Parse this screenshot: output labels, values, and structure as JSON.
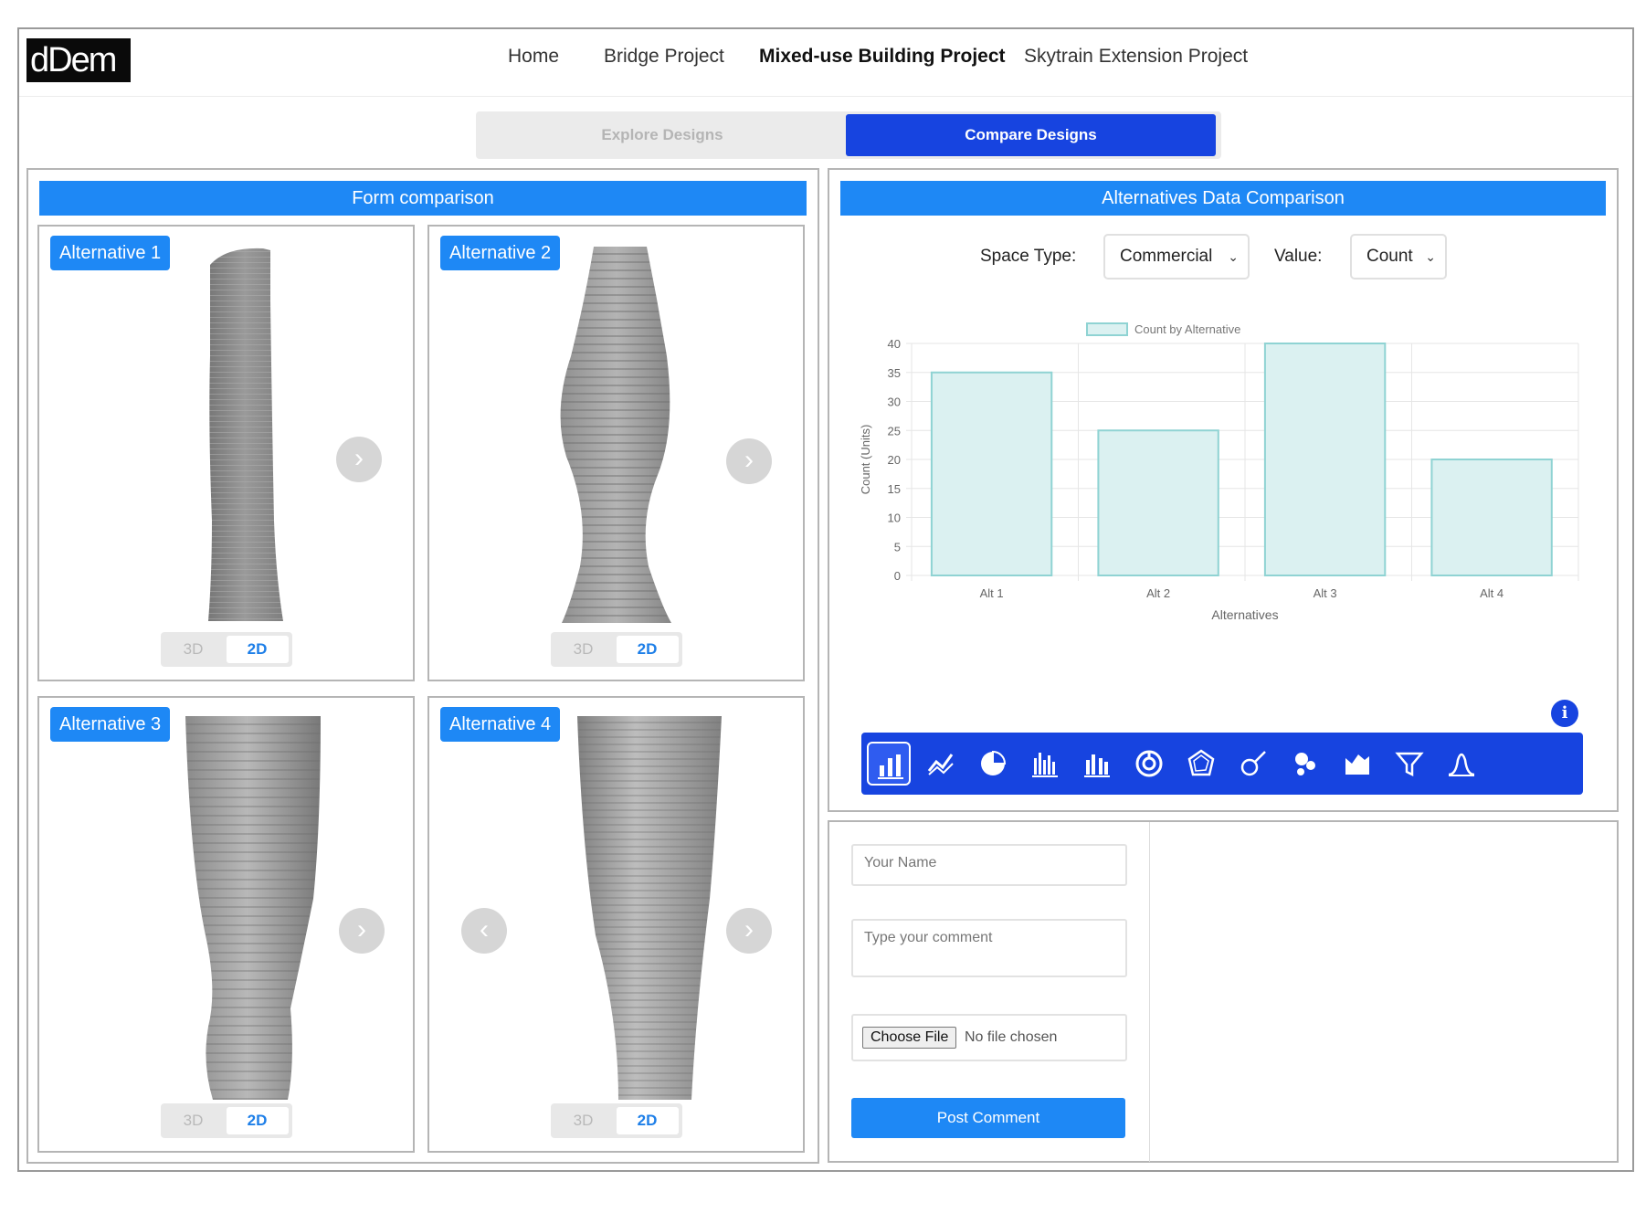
{
  "logo": {
    "text": "dDem"
  },
  "nav": {
    "items": [
      {
        "label": "Home"
      },
      {
        "label": "Bridge Project"
      },
      {
        "label": "Mixed-use Building Project"
      },
      {
        "label": "Skytrain Extension Project"
      }
    ],
    "active_index": 2
  },
  "mode_toggle": {
    "explore_label": "Explore Designs",
    "compare_label": "Compare Designs",
    "active": "compare"
  },
  "form_comparison": {
    "title": "Form comparison",
    "alternatives": [
      {
        "label": "Alternative 1",
        "toggle_3d": "3D",
        "toggle_2d": "2D",
        "active_view": "2D",
        "arrows": [
          "chevron-right"
        ]
      },
      {
        "label": "Alternative 2",
        "toggle_3d": "3D",
        "toggle_2d": "2D",
        "active_view": "2D",
        "arrows": [
          "chevron-right"
        ]
      },
      {
        "label": "Alternative 3",
        "toggle_3d": "3D",
        "toggle_2d": "2D",
        "active_view": "2D",
        "arrows": [
          "chevron-right"
        ]
      },
      {
        "label": "Alternative 4",
        "toggle_3d": "3D",
        "toggle_2d": "2D",
        "active_view": "2D",
        "arrows": [
          "chevron-left",
          "chevron-right"
        ]
      }
    ]
  },
  "data_comparison": {
    "title": "Alternatives Data Comparison",
    "space_type_label": "Space Type:",
    "space_type_value": "Commercial",
    "value_label": "Value:",
    "value_value": "Count",
    "info_icon": "i"
  },
  "chart_data": {
    "type": "bar",
    "categories": [
      "Alt 1",
      "Alt 2",
      "Alt 3",
      "Alt 4"
    ],
    "series": [
      {
        "name": "Count by Alternative",
        "values": [
          35,
          25,
          40,
          20
        ]
      }
    ],
    "xlabel": "Alternatives",
    "ylabel": "Count (Units)",
    "ylim": [
      0,
      40
    ],
    "yticks": [
      0,
      5,
      10,
      15,
      20,
      25,
      30,
      35,
      40
    ],
    "grid": true,
    "legend_position": "top",
    "bar_fill": "#dbf1f1",
    "bar_stroke": "#8fd3d3"
  },
  "chart_toolbar": {
    "tools": [
      "bar-chart-icon",
      "line-chart-icon",
      "pie-chart-icon",
      "histogram-icon",
      "grouped-bar-icon",
      "donut-chart-icon",
      "radar-chart-icon",
      "scatter-chart-icon",
      "bubble-chart-icon",
      "area-chart-icon",
      "funnel-chart-icon",
      "distribution-chart-icon"
    ],
    "selected_index": 0
  },
  "comments": {
    "name_placeholder": "Your Name",
    "comment_placeholder": "Type your comment",
    "file_button": "Choose File",
    "file_status": "No file chosen",
    "post_button": "Post Comment"
  },
  "colors": {
    "accent_blue": "#1e88f5",
    "dark_blue": "#1744e0",
    "tower_gray": "#8a8a8a"
  }
}
